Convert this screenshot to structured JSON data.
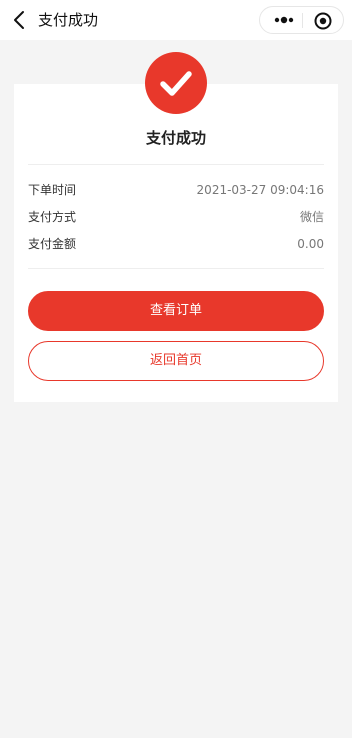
{
  "nav": {
    "title": "支付成功",
    "back_icon": "chevron-left-icon",
    "more_icon": "more-dots-icon",
    "close_icon": "target-circle-icon"
  },
  "status": {
    "icon": "check-circle-icon",
    "title": "支付成功"
  },
  "details": [
    {
      "label": "下单时间",
      "value": "2021-03-27 09:04:16"
    },
    {
      "label": "支付方式",
      "value": "微信"
    },
    {
      "label": "支付金额",
      "value": "0.00"
    }
  ],
  "actions": {
    "view_order": "查看订单",
    "back_home": "返回首页"
  },
  "colors": {
    "accent": "#e8382b",
    "background": "#f4f4f4",
    "card": "#ffffff"
  }
}
